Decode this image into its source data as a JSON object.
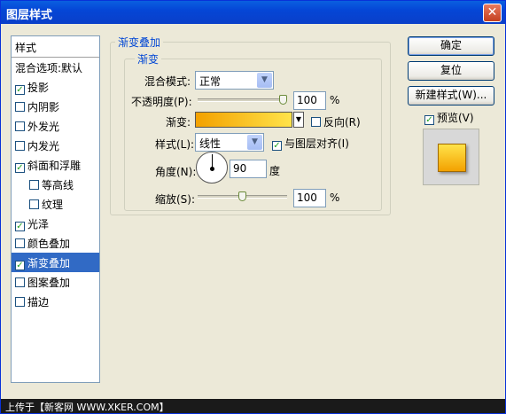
{
  "window": {
    "title": "图层样式",
    "close_symbol": "✕"
  },
  "styles_list": {
    "header": "样式",
    "blend_options": "混合选项:默认",
    "items": [
      {
        "label": "投影",
        "checked": true,
        "indent": false,
        "selected": false
      },
      {
        "label": "内阴影",
        "checked": false,
        "indent": false,
        "selected": false
      },
      {
        "label": "外发光",
        "checked": false,
        "indent": false,
        "selected": false
      },
      {
        "label": "内发光",
        "checked": false,
        "indent": false,
        "selected": false
      },
      {
        "label": "斜面和浮雕",
        "checked": true,
        "indent": false,
        "selected": false
      },
      {
        "label": "等高线",
        "checked": false,
        "indent": true,
        "selected": false
      },
      {
        "label": "纹理",
        "checked": false,
        "indent": true,
        "selected": false
      },
      {
        "label": "光泽",
        "checked": true,
        "indent": false,
        "selected": false
      },
      {
        "label": "颜色叠加",
        "checked": false,
        "indent": false,
        "selected": false
      },
      {
        "label": "渐变叠加",
        "checked": true,
        "indent": false,
        "selected": true
      },
      {
        "label": "图案叠加",
        "checked": false,
        "indent": false,
        "selected": false
      },
      {
        "label": "描边",
        "checked": false,
        "indent": false,
        "selected": false
      }
    ]
  },
  "panel": {
    "outer_legend": "渐变叠加",
    "inner_legend": "渐变",
    "blend_mode_label": "混合模式:",
    "blend_mode_value": "正常",
    "opacity_label": "不透明度(P):",
    "opacity_value": "100",
    "opacity_level": 1.0,
    "gradient_label": "渐变:",
    "reverse_label": "反向(R)",
    "reverse_checked": false,
    "style_label": "样式(L):",
    "style_value": "线性",
    "align_label": "与图层对齐(I)",
    "align_checked": true,
    "angle_label": "角度(N):",
    "angle_value": "90",
    "angle_unit": "度",
    "scale_label": "缩放(S):",
    "scale_value": "100",
    "scale_level": 0.5,
    "percent": "%"
  },
  "buttons": {
    "ok": "确定",
    "reset": "复位",
    "new_style": "新建样式(W)...",
    "preview_label": "预览(V)",
    "preview_checked": true
  },
  "footer": {
    "text": "上传于【新客网 WWW.XKER.COM】"
  },
  "colors": {
    "gradient_start": "#f3a100",
    "gradient_end": "#ffe34a",
    "selection": "#316ac5"
  }
}
